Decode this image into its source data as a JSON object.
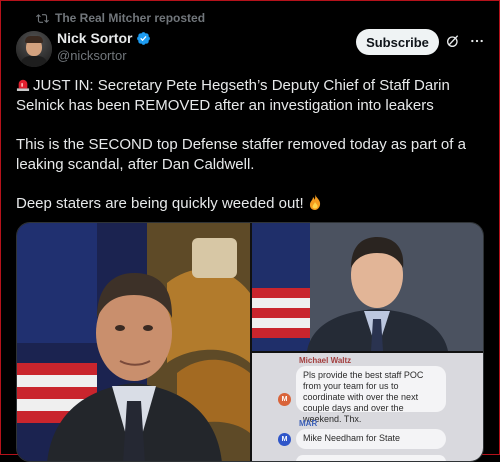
{
  "repost": {
    "text": "The Real Mitcher reposted",
    "icon": "repost-icon"
  },
  "author": {
    "name": "Nick Sortor",
    "handle": "@nicksortor",
    "verified": true,
    "avatar_icon": "avatar"
  },
  "actions": {
    "subscribe_label": "Subscribe",
    "grok_icon": "grok-icon",
    "more_icon": "more-icon"
  },
  "post": {
    "p1": "JUST IN: Secretary Pete Hegseth’s Deputy Chief of Staff Darin Selnick has been REMOVED after an investigation into leakers",
    "p2": "This is the SECOND top Defense staffer removed today as part of a leaking scandal, after Dan Caldwell.",
    "p3": "Deep staters are being quickly weeded out!",
    "siren_icon": "siren-emoji",
    "fire_icon": "fire-emoji"
  },
  "media": {
    "chat": {
      "sender1": "Michael Waltz",
      "message1": "Pls provide the best staff POC from your team for us to coordinate with over the next couple days and over the weekend. Thx.",
      "avatar1": "M",
      "sender2": "MAR",
      "message2": "Mike Needham for State",
      "avatar2": "M"
    }
  },
  "colors": {
    "accent_blue": "#1d9bf0",
    "frame_red": "#b5121b",
    "muted_gray": "#71767b",
    "text": "#e7e9ea"
  }
}
